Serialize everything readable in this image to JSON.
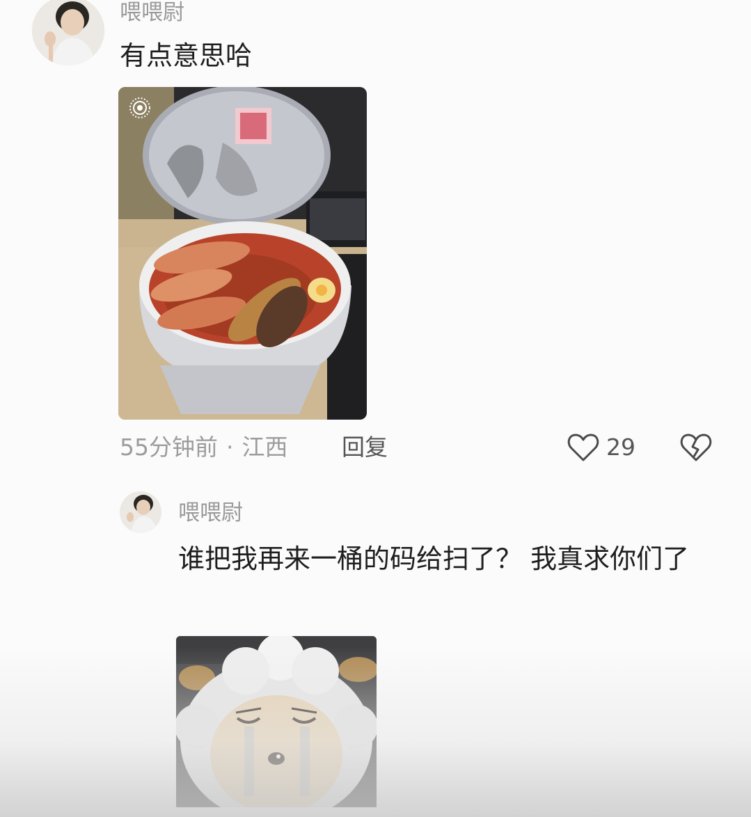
{
  "main_comment": {
    "username": "喂喂尉",
    "text": "有点意思哈",
    "time": "55分钟前",
    "separator": "·",
    "location": "江西",
    "reply_label": "回复",
    "like_count": "29"
  },
  "reply_comment": {
    "username": "喂喂尉",
    "text": "谁把我再来一桶的码给扫了？ 我真求你们了"
  },
  "colors": {
    "background": "#fbfbfb",
    "meta_text": "#9c9c9c",
    "body_text": "#1e1e1e"
  },
  "icons": {
    "like": "heart-outline-icon",
    "dislike": "broken-heart-icon",
    "live_photo": "live-photo-icon"
  }
}
